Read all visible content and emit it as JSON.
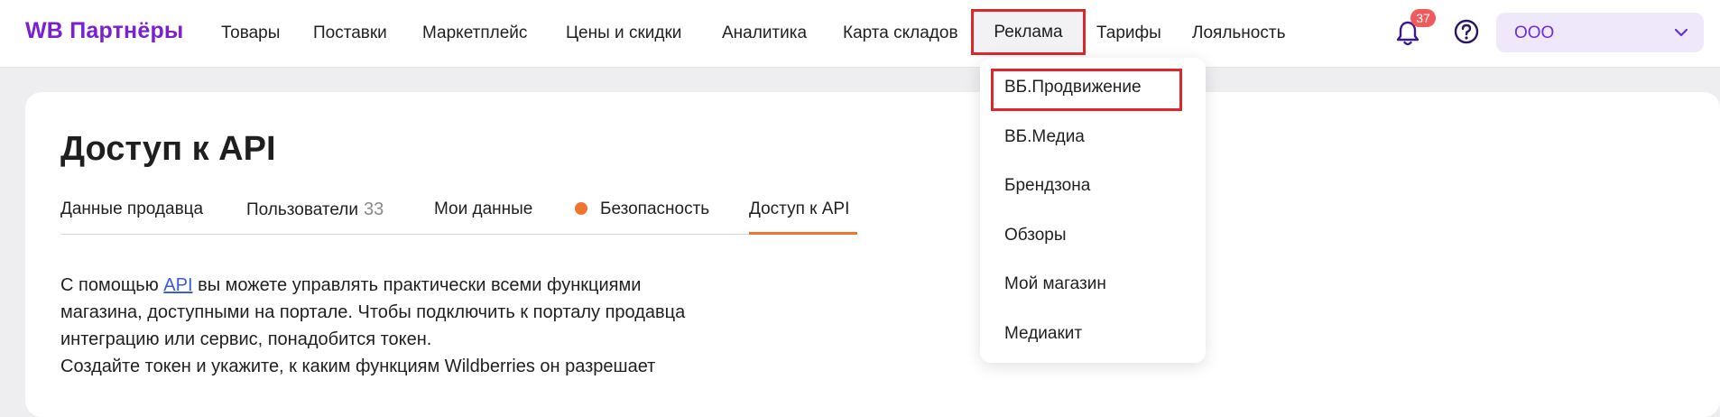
{
  "header": {
    "logo": "WB Партнёры",
    "nav": [
      "Товары",
      "Поставки",
      "Маркетплейс",
      "Цены и скидки",
      "Аналитика",
      "Карта складов",
      "Реклама",
      "Тарифы",
      "Лояльность"
    ],
    "notification_count": "37",
    "org_name": "ООО"
  },
  "page": {
    "title": "Доступ к API",
    "tabs": {
      "seller_data": "Данные продавца",
      "users": "Пользователи",
      "users_count": "33",
      "my_data": "Мои данные",
      "security": "Безопасность",
      "api_access": "Доступ к API"
    },
    "description": {
      "prefix": "С помощью ",
      "link": "API",
      "line1_rest": " вы можете управлять практически всеми функциями",
      "line2": "магазина, доступными на портале. Чтобы подключить к порталу продавца",
      "line3": "интеграцию или сервис, понадобится токен.",
      "line4": "Создайте токен и укажите, к каким функциям Wildberries он разрешает"
    }
  },
  "dropdown": {
    "items": [
      "ВБ.Продвижение",
      "ВБ.Медиа",
      "Брендзона",
      "Обзоры",
      "Мой магазин",
      "Медиакит"
    ]
  },
  "colors": {
    "brand": "#7a1fd1",
    "accent": "#f0742e",
    "highlight": "#e0262d",
    "link": "#3b5bdb"
  }
}
